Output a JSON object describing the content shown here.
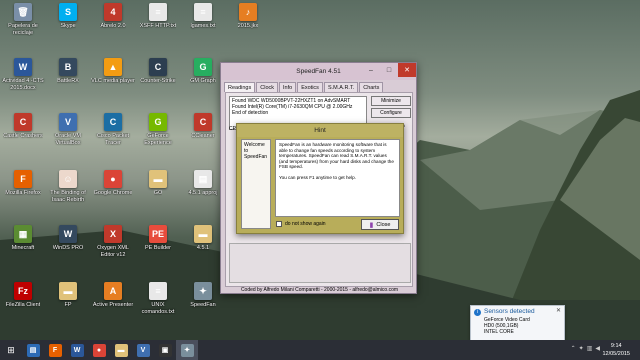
{
  "desktop": {
    "icons": [
      {
        "label": "Papelera de reciclaje",
        "color": "#7a8fa8",
        "glyph": "🗑"
      },
      {
        "label": "Skype",
        "color": "#00aff0",
        "glyph": "S"
      },
      {
        "label": "Abrelo 2.0",
        "color": "#c0392b",
        "glyph": "4"
      },
      {
        "label": "XSFF HTTP.txt",
        "color": "#e8e8e8",
        "glyph": "≡"
      },
      {
        "label": "lgames.txt",
        "color": "#e8e8e8",
        "glyph": "≡"
      },
      {
        "label": "2015.jkx",
        "color": "#e67e22",
        "glyph": "♪"
      },
      {
        "label": "Actividad 4 -CTS 2015.docx",
        "color": "#2b579a",
        "glyph": "W"
      },
      {
        "label": "BattleRX",
        "color": "#34495e",
        "glyph": "B"
      },
      {
        "label": "VLC media player",
        "color": "#f39c12",
        "glyph": "▲"
      },
      {
        "label": "Counter-Strike",
        "color": "#2c3e50",
        "glyph": "C"
      },
      {
        "label": "GM Graph",
        "color": "#27ae60",
        "glyph": "G"
      },
      {
        "label": "Castle Crashers",
        "color": "#c0392b",
        "glyph": "C"
      },
      {
        "label": "Oracle VM VirtualBox",
        "color": "#3f6fb0",
        "glyph": "V"
      },
      {
        "label": "Cisco Packet Tracer",
        "color": "#1c6ea4",
        "glyph": "C"
      },
      {
        "label": "GeForce Experience",
        "color": "#76b900",
        "glyph": "G"
      },
      {
        "label": "CCleaner",
        "color": "#c0392b",
        "glyph": "C"
      },
      {
        "label": "Mozilla Firefox",
        "color": "#e66000",
        "glyph": "F"
      },
      {
        "label": "The Binding of Isaac Rebirth",
        "color": "#ecd8cc",
        "glyph": "☺"
      },
      {
        "label": "Google Chrome",
        "color": "#db4437",
        "glyph": "●"
      },
      {
        "label": "GO",
        "color": "#e0c27a",
        "glyph": "▬"
      },
      {
        "label": "4.5.1 approj",
        "color": "#e8e8e8",
        "glyph": "▤"
      },
      {
        "label": "Minecraft",
        "color": "#5b8c32",
        "glyph": "▦"
      },
      {
        "label": "WinDS PRO",
        "color": "#34495e",
        "glyph": "W"
      },
      {
        "label": "Oxygen XML Editor v12",
        "color": "#c0392b",
        "glyph": "X"
      },
      {
        "label": "PE Builder",
        "color": "#e74c3c",
        "glyph": "PE"
      },
      {
        "label": "4.5.1",
        "color": "#e0c27a",
        "glyph": "▬"
      },
      {
        "label": "FileZilla Client",
        "color": "#bf0000",
        "glyph": "Fz"
      },
      {
        "label": "FP",
        "color": "#e0c27a",
        "glyph": "▬"
      },
      {
        "label": "Active Presenter",
        "color": "#e67e22",
        "glyph": "A"
      },
      {
        "label": "UNIX comandos.txt",
        "color": "#e8e8e8",
        "glyph": "≡"
      },
      {
        "label": "SpeedFan",
        "color": "#7a8f9c",
        "glyph": "✦"
      }
    ]
  },
  "speedfan": {
    "title": "SpeedFan 4.51",
    "tabs": [
      "Readings",
      "Clock",
      "Info",
      "Exotics",
      "S.M.A.R.T.",
      "Charts"
    ],
    "log_lines": [
      "Found WDC WD5000BPVT-22HXZT1 on AdvSMART",
      "Found Intel(R) Core(TM) i7-2630QM CPU @ 2.00GHz",
      "End of detection"
    ],
    "buttons": {
      "minimize": "Minimize",
      "configure": "Configure",
      "automatic": "Automatic fan"
    },
    "footer": "Coded by Alfredo Milani Comparetti - 2000-2015 - alfredo@almico.com",
    "cpu_label": "CPU"
  },
  "hint": {
    "title": "Hint",
    "welcome": "Welcome to SpeedFan",
    "paragraph1": "SpeedFan is an hardware monitoring software that is able to change fan speeds according to system temperatures. SpeedFan can read S.M.A.R.T. values (and temperatures) from your hard disks and change the FSB speed.",
    "paragraph2": "You can press F1 anytime to get help.",
    "checkbox": "do not show again",
    "close": "Close"
  },
  "notification": {
    "title": "Sensors detected",
    "lines": [
      "GeForce Video Card",
      "HD0 (500,1GB)",
      "INTEL CORE"
    ]
  },
  "taskbar": {
    "time": "9:14",
    "date": "12/05/2015",
    "apps": [
      {
        "name": "file-explorer",
        "color": "#2d6bb5",
        "glyph": "▤"
      },
      {
        "name": "firefox",
        "color": "#e66000",
        "glyph": "F"
      },
      {
        "name": "word",
        "color": "#2b579a",
        "glyph": "W"
      },
      {
        "name": "chrome",
        "color": "#db4437",
        "glyph": "●"
      },
      {
        "name": "folder",
        "color": "#e0c27a",
        "glyph": "▬"
      },
      {
        "name": "virtualbox",
        "color": "#3f6fb0",
        "glyph": "V"
      },
      {
        "name": "terminal",
        "color": "#333",
        "glyph": "▣"
      },
      {
        "name": "speedfan",
        "color": "#7a8f9c",
        "glyph": "✦"
      }
    ]
  }
}
